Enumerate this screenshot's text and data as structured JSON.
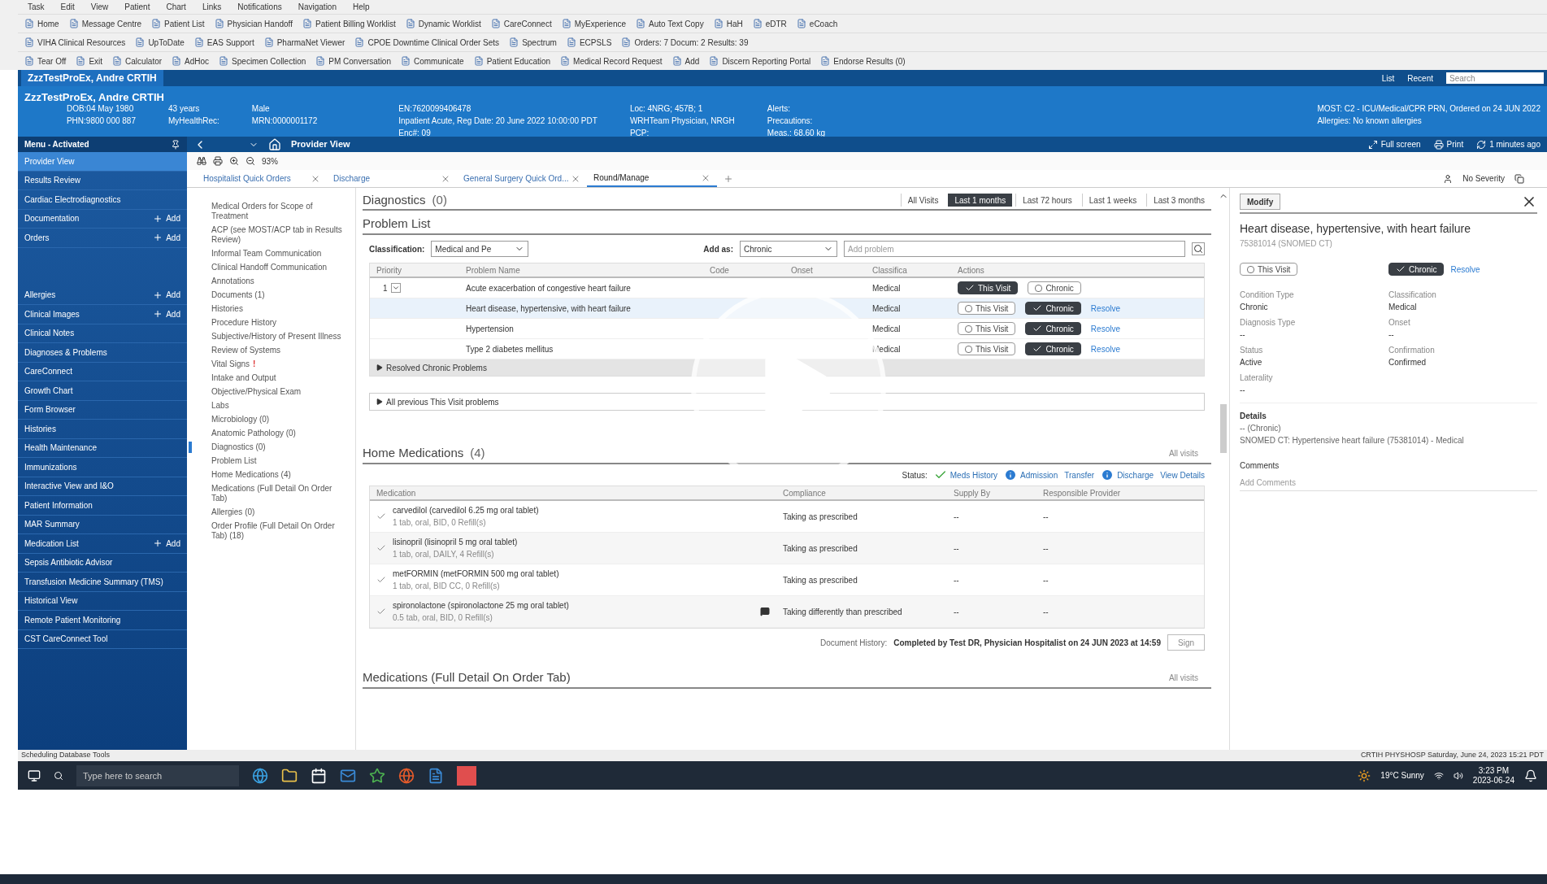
{
  "menu_bar": [
    "Task",
    "Edit",
    "View",
    "Patient",
    "Chart",
    "Links",
    "Notifications",
    "Navigation",
    "Help"
  ],
  "toolbars": [
    [
      "Home",
      "Message Centre",
      "Patient List",
      "Physician Handoff",
      "Patient Billing Worklist",
      "Dynamic Worklist",
      "CareConnect",
      "MyExperience",
      "Auto Text Copy",
      "HaH",
      "eDTR",
      "eCoach"
    ],
    [
      "VIHA Clinical Resources",
      "UpToDate",
      "EAS Support",
      "PharmaNet Viewer",
      "CPOE Downtime Clinical Order Sets",
      "Spectrum",
      "ECPSLS",
      "Orders: 7  Docum: 2  Results: 39"
    ],
    [
      "Tear Off",
      "Exit",
      "Calculator",
      "AdHoc",
      "Specimen Collection",
      "PM Conversation",
      "Communicate",
      "Patient Education",
      "Medical Record Request",
      "Add",
      "Discern Reporting Portal",
      "Endorse Results (0)"
    ]
  ],
  "patient_tab": {
    "label": "ZzzTestProEx, Andre CRTIH",
    "right": [
      "List",
      "Recent"
    ],
    "search_placeholder": "Search"
  },
  "banner": {
    "name": "ZzzTestProEx, Andre CRTIH",
    "columns": [
      [
        "DOB:04 May 1980",
        "PHN:9800 000 887"
      ],
      [
        "43 years",
        "MyHealthRec:"
      ],
      [
        "Male",
        "MRN:0000001172"
      ],
      [
        "EN:7620099406478",
        "Inpatient Acute, Reg Date: 20 June 2022 10:00:00 PDT",
        "Enc#: 09"
      ],
      [
        "Loc: 4NRG; 457B; 1",
        "WRHTeam Physician, NRGH",
        "PCP:"
      ],
      [
        "Alerts:",
        "Precautions:",
        "Meas.: 68.60 kg"
      ],
      [
        "MOST: C2 - ICU/Medical/CPR PRN, Ordered on 24 JUN 2022",
        "Allergies: No known allergies"
      ]
    ]
  },
  "nav": {
    "title": "Menu - Activated",
    "items": [
      {
        "label": "Provider View",
        "selected": true,
        "add": false
      },
      {
        "label": "Results Review",
        "selected": false,
        "add": false
      },
      {
        "label": "Cardiac Electrodiagnostics",
        "selected": false,
        "add": false
      },
      {
        "label": "Documentation",
        "selected": false,
        "add": "Add"
      },
      {
        "label": "Orders",
        "selected": false,
        "add": "Add"
      },
      {
        "label": "Allergies",
        "selected": false,
        "add": "Add"
      },
      {
        "label": "Clinical Images",
        "selected": false,
        "add": "Add"
      },
      {
        "label": "Clinical Notes",
        "selected": false,
        "add": false
      },
      {
        "label": "Diagnoses & Problems",
        "selected": false,
        "add": false
      },
      {
        "label": "CareConnect",
        "selected": false,
        "add": false
      },
      {
        "label": "Growth Chart",
        "selected": false,
        "add": false
      },
      {
        "label": "Form Browser",
        "selected": false,
        "add": false
      },
      {
        "label": "Histories",
        "selected": false,
        "add": false
      },
      {
        "label": "Health Maintenance",
        "selected": false,
        "add": false
      },
      {
        "label": "Immunizations",
        "selected": false,
        "add": false
      },
      {
        "label": "Interactive View and I&O",
        "selected": false,
        "add": false
      },
      {
        "label": "Patient Information",
        "selected": false,
        "add": false
      },
      {
        "label": "MAR Summary",
        "selected": false,
        "add": false
      },
      {
        "label": "Medication List",
        "selected": false,
        "add": "Add"
      },
      {
        "label": "Sepsis Antibiotic Advisor",
        "selected": false,
        "add": false
      },
      {
        "label": "Transfusion Medicine Summary (TMS)",
        "selected": false,
        "add": false
      },
      {
        "label": "Historical View",
        "selected": false,
        "add": false
      },
      {
        "label": "Remote Patient Monitoring",
        "selected": false,
        "add": false
      },
      {
        "label": "CST CareConnect Tool",
        "selected": false,
        "add": false
      }
    ]
  },
  "view_bar": {
    "title": "Provider View",
    "actions": [
      "Full screen",
      "Print",
      "1 minutes ago"
    ]
  },
  "zoom_level": "93%",
  "tabs": [
    {
      "label": "Hospitalist Quick Orders",
      "selected": false
    },
    {
      "label": "Discharge",
      "selected": false
    },
    {
      "label": "General Surgery Quick Ord...",
      "selected": false
    },
    {
      "label": "Round/Manage",
      "selected": true
    }
  ],
  "tab_tools": {
    "severity": "No Severity"
  },
  "sections": [
    {
      "label": "Medical Orders for Scope of Treatment",
      "selected": false
    },
    {
      "label": "ACP (see MOST/ACP tab in Results Review)",
      "selected": false
    },
    {
      "label": "Informal Team Communication",
      "selected": false
    },
    {
      "label": "Clinical Handoff Communication",
      "selected": false
    },
    {
      "label": "Annotations",
      "selected": false
    },
    {
      "label": "Documents (1)",
      "selected": false
    },
    {
      "label": "Histories",
      "selected": false
    },
    {
      "label": "Procedure History",
      "selected": false
    },
    {
      "label": "Subjective/History of Present Illness",
      "selected": false
    },
    {
      "label": "Review of Systems",
      "selected": false
    },
    {
      "label": "Vital Signs",
      "selected": false,
      "alert": "!"
    },
    {
      "label": "Intake and Output",
      "selected": false
    },
    {
      "label": "Objective/Physical Exam",
      "selected": false
    },
    {
      "label": "Labs",
      "selected": false
    },
    {
      "label": "Microbiology (0)",
      "selected": false
    },
    {
      "label": "Anatomic Pathology (0)",
      "selected": false
    },
    {
      "label": "Diagnostics (0)",
      "selected": true
    },
    {
      "label": "Problem List",
      "selected": false
    },
    {
      "label": "Home Medications (4)",
      "selected": false
    },
    {
      "label": "Medications (Full Detail On Order Tab)",
      "selected": false
    },
    {
      "label": "Allergies (0)",
      "selected": false
    },
    {
      "label": "Order Profile (Full Detail On Order Tab) (18)",
      "selected": false
    }
  ],
  "diagnostics": {
    "title": "Diagnostics",
    "count": "(0)",
    "filters": [
      {
        "label": "All Visits",
        "selected": false
      },
      {
        "label": "Last 1 months",
        "selected": true
      },
      {
        "label": "Last 72 hours",
        "selected": false
      },
      {
        "label": "Last 1 weeks",
        "selected": false
      },
      {
        "label": "Last 3 months",
        "selected": false
      }
    ]
  },
  "problem_list": {
    "title": "Problem List",
    "classification_label": "Classification:",
    "classification": "Medical and Pe",
    "add_as_label": "Add as:",
    "add_as": "Chronic",
    "add_placeholder": "Add problem",
    "columns": [
      "Priority",
      "Problem Name",
      "Code",
      "Onset",
      "Classifica",
      "Actions"
    ],
    "rows": [
      {
        "priority": "1",
        "name": "Acute exacerbation of congestive heart failure",
        "classification": "Medical",
        "selected": false,
        "actions": [
          {
            "label": "This Visit",
            "checked": true
          },
          {
            "label": "Chronic",
            "checked": false
          }
        ],
        "resolve": ""
      },
      {
        "priority": "",
        "name": "Heart disease, hypertensive, with heart failure",
        "classification": "Medical",
        "selected": true,
        "actions": [
          {
            "label": "This Visit",
            "checked": false
          },
          {
            "label": "Chronic",
            "checked": true
          }
        ],
        "resolve": "Resolve"
      },
      {
        "priority": "",
        "name": "Hypertension",
        "classification": "Medical",
        "selected": false,
        "actions": [
          {
            "label": "This Visit",
            "checked": false
          },
          {
            "label": "Chronic",
            "checked": true
          }
        ],
        "resolve": "Resolve"
      },
      {
        "priority": "",
        "name": "Type 2 diabetes mellitus",
        "classification": "Medical",
        "selected": false,
        "actions": [
          {
            "label": "This Visit",
            "checked": false
          },
          {
            "label": "Chronic",
            "checked": true
          }
        ],
        "resolve": "Resolve"
      }
    ],
    "resolved": "Resolved Chronic Problems",
    "previous": "All previous This Visit problems"
  },
  "home_meds": {
    "title": "Home Medications",
    "count": "(4)",
    "visits": "All visits",
    "status_label": "Status:",
    "status": [
      {
        "label": "Meds History",
        "kind": "done"
      },
      {
        "label": "Admission",
        "kind": "info"
      },
      {
        "label": "Transfer",
        "kind": "plain"
      },
      {
        "label": "Discharge",
        "kind": "info"
      },
      {
        "label": "View Details",
        "kind": "plain"
      }
    ],
    "columns": [
      "Medication",
      "Compliance",
      "Supply By",
      "Responsible Provider"
    ],
    "rows": [
      {
        "name": "carvedilol (carvedilol 6.25 mg oral tablet)",
        "detail": "1 tab, oral, BID, 0 Refill(s)",
        "comment": false,
        "compliance": "Taking as prescribed",
        "supply": "--",
        "provider": "--"
      },
      {
        "name": "lisinopril (lisinopril 5 mg oral tablet)",
        "detail": "1 tab, oral, DAILY, 4 Refill(s)",
        "comment": false,
        "compliance": "Taking as prescribed",
        "supply": "--",
        "provider": "--"
      },
      {
        "name": "metFORMIN (metFORMIN 500 mg oral tablet)",
        "detail": "1 tab, oral, BID CC, 0 Refill(s)",
        "comment": false,
        "compliance": "Taking as prescribed",
        "supply": "--",
        "provider": "--"
      },
      {
        "name": "spironolactone (spironolactone 25 mg oral tablet)",
        "detail": "0.5 tab, oral, BID, 0 Refill(s)",
        "comment": true,
        "compliance": "Taking differently than prescribed",
        "supply": "--",
        "provider": "--"
      }
    ],
    "history_label": "Document History:",
    "history": "Completed by Test DR, Physician Hospitalist on 24 JUN 2023 at 14:59",
    "sign": "Sign"
  },
  "medications": {
    "title": "Medications (Full Detail On Order Tab)",
    "visits": "All visits"
  },
  "detail": {
    "modify": "Modify",
    "title": "Heart disease, hypertensive, with heart failure",
    "code": "75381014 (SNOMED CT)",
    "actions": [
      {
        "label": "This Visit",
        "checked": false
      },
      {
        "label": "Chronic",
        "checked": true
      }
    ],
    "resolve": "Resolve",
    "fields": [
      {
        "label": "Condition Type",
        "value": "Chronic"
      },
      {
        "label": "Classification",
        "value": "Medical"
      },
      {
        "label": "Diagnosis Type",
        "value": "--"
      },
      {
        "label": "Onset",
        "value": "--"
      },
      {
        "label": "Status",
        "value": "Active"
      },
      {
        "label": "Confirmation",
        "value": "Confirmed"
      },
      {
        "label": "Laterality",
        "value": "--"
      }
    ],
    "details_title": "Details",
    "details": [
      "-- (Chronic)",
      "SNOMED CT: Hypertensive heart failure (75381014) - Medical"
    ],
    "comments_title": "Comments",
    "comments_placeholder": "Add Comments"
  },
  "status_bar": {
    "left": "Scheduling Database Tools",
    "right": "CRTIH  PHYSHOSP  Saturday, June 24, 2023  15:21 PDT"
  },
  "taskbar": {
    "search_placeholder": "Type here to search",
    "weather": "19°C  Sunny",
    "time": "3:23 PM",
    "date": "2023-06-24"
  }
}
